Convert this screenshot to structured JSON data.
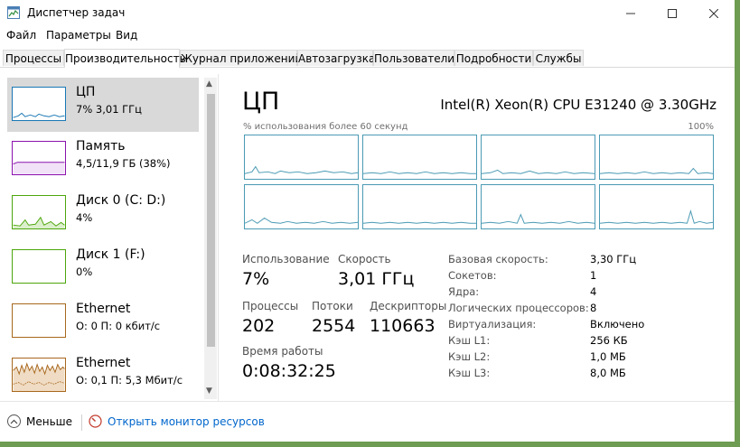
{
  "window": {
    "title": "Диспетчер задач",
    "minimize_glyph": "—",
    "maximize_glyph": "☐",
    "close_glyph": "✕"
  },
  "menu": [
    "Файл",
    "Параметры",
    "Вид"
  ],
  "tabs": [
    "Процессы",
    "Производительность",
    "Журнал приложений",
    "Автозагрузка",
    "Пользователи",
    "Подробности",
    "Службы"
  ],
  "active_tab": "Производительность",
  "sidebar": {
    "items": [
      {
        "title": "ЦП",
        "subtitle": "7% 3,01 ГГц",
        "color": "#1a78b4",
        "graph": "cpu"
      },
      {
        "title": "Память",
        "subtitle": "4,5/11,9 ГБ (38%)",
        "color": "#8b12ae",
        "graph": "memory"
      },
      {
        "title": "Диск 0 (C: D:)",
        "subtitle": "4%",
        "color": "#4da60c",
        "graph": "disk0"
      },
      {
        "title": "Диск 1 (F:)",
        "subtitle": "0%",
        "color": "#4da60c",
        "graph": "disk1"
      },
      {
        "title": "Ethernet",
        "subtitle": "О: 0 П: 0 кбит/с",
        "color": "#a7671d",
        "graph": "eth0"
      },
      {
        "title": "Ethernet",
        "subtitle": "О: 0,1 П: 5,3 Мбит/с",
        "color": "#a7671d",
        "graph": "eth1"
      }
    ],
    "scroll_up": "▲",
    "scroll_down": "▼"
  },
  "main": {
    "title": "ЦП",
    "cpu_model": "Intel(R) Xeon(R) CPU E31240 @ 3.30GHz",
    "graph_label": "% использования более 60 секунд",
    "graph_max": "100%",
    "graph_color": "#4b9ab4",
    "stats": {
      "usage_label": "Использование",
      "usage_value": "7%",
      "speed_label": "Скорость",
      "speed_value": "3,01 ГГц",
      "processes_label": "Процессы",
      "processes_value": "202",
      "threads_label": "Потоки",
      "threads_value": "2554",
      "handles_label": "Дескрипторы",
      "handles_value": "110663",
      "uptime_label": "Время работы",
      "uptime_value": "0:08:32:25"
    },
    "info": [
      {
        "label": "Базовая скорость:",
        "value": "3,30 ГГц"
      },
      {
        "label": "Сокетов:",
        "value": "1"
      },
      {
        "label": "Ядра:",
        "value": "4"
      },
      {
        "label": "Логических процессоров:",
        "value": "8"
      },
      {
        "label": "Виртуализация:",
        "value": "Включено"
      },
      {
        "label": "Кэш L1:",
        "value": "256 КБ"
      },
      {
        "label": "Кэш L2:",
        "value": "1,0 МБ"
      },
      {
        "label": "Кэш L3:",
        "value": "8,0 МБ"
      }
    ]
  },
  "footer": {
    "fewer_details": "Меньше",
    "open_monitor": "Открыть монитор ресурсов"
  }
}
